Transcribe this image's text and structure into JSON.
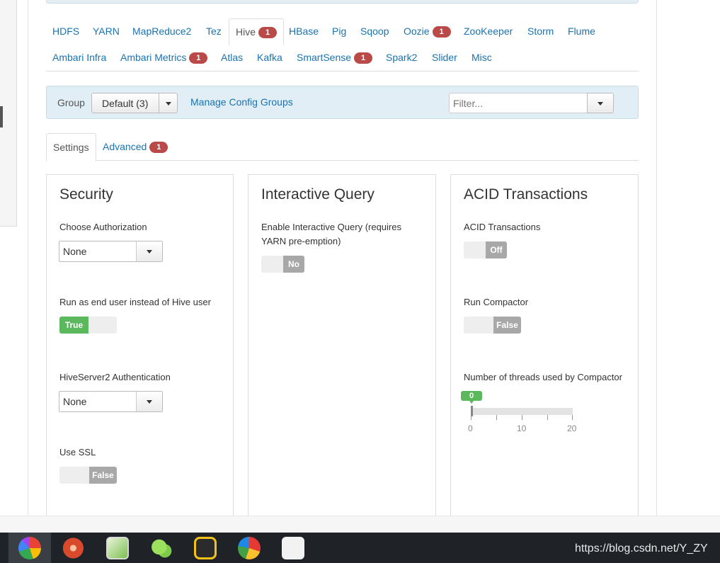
{
  "service_tabs": [
    {
      "label": "HDFS"
    },
    {
      "label": "YARN"
    },
    {
      "label": "MapReduce2"
    },
    {
      "label": "Tez"
    },
    {
      "label": "Hive",
      "badge": "1"
    },
    {
      "label": "HBase"
    },
    {
      "label": "Pig"
    },
    {
      "label": "Sqoop"
    },
    {
      "label": "Oozie",
      "badge": "1"
    },
    {
      "label": "ZooKeeper"
    },
    {
      "label": "Storm"
    },
    {
      "label": "Flume"
    },
    {
      "label": "Ambari Infra"
    },
    {
      "label": "Ambari Metrics",
      "badge": "1"
    },
    {
      "label": "Atlas"
    },
    {
      "label": "Kafka"
    },
    {
      "label": "SmartSense",
      "badge": "1"
    },
    {
      "label": "Spark2"
    },
    {
      "label": "Slider"
    },
    {
      "label": "Misc"
    }
  ],
  "active_service": "Hive",
  "group_bar": {
    "label": "Group",
    "selected": "Default (3)",
    "manage_link": "Manage Config Groups",
    "filter_placeholder": "Filter..."
  },
  "sub_tabs": [
    {
      "label": "Settings"
    },
    {
      "label": "Advanced",
      "badge": "1"
    }
  ],
  "cards": {
    "security": {
      "title": "Security",
      "choose_authorization": {
        "label": "Choose Authorization",
        "value": "None"
      },
      "run_as_end_user": {
        "label": "Run as end user instead of Hive user",
        "value": "True"
      },
      "hs2_authentication": {
        "label": "HiveServer2 Authentication",
        "value": "None"
      },
      "use_ssl": {
        "label": "Use SSL",
        "value": "False"
      }
    },
    "interactive_query": {
      "title": "Interactive Query",
      "enable_label_line1": "Enable Interactive Query (requires",
      "enable_label_line2": "YARN pre-emption)",
      "enable_value": "No"
    },
    "acid": {
      "title": "ACID Transactions",
      "acid_transactions": {
        "label": "ACID Transactions",
        "value": "Off"
      },
      "run_compactor": {
        "label": "Run Compactor",
        "value": "False"
      },
      "threads": {
        "label": "Number of threads used by Compactor",
        "value": "0",
        "ticks": [
          "0",
          "10",
          "20"
        ],
        "min": 0,
        "max": 20
      }
    }
  },
  "taskbar": {
    "watermark": "https://blog.csdn.net/Y_ZY"
  },
  "colors": {
    "link": "#1a73b0",
    "badge": "#b94a48",
    "toggle_on": "#5cb85c",
    "toggle_off": "#a8a8a8",
    "panel_bg": "#e1eef5"
  }
}
